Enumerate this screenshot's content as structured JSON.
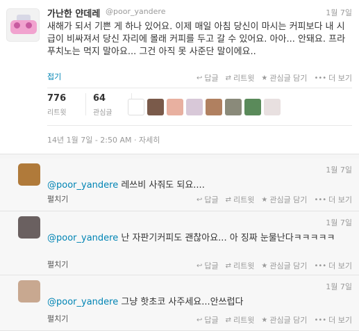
{
  "main_tweet": {
    "name": "가난한 얀데레",
    "handle": "@poor_yandere",
    "time": "1월 7일",
    "text": "새해가 되서 기쁜 게 하나 있어요. 이제 매일 아침 당신이 마시는 커피보다 내 시급이 비싸져서 당신 자리에 몰래 커피를 두고 갈 수 있어요. 아아... 안돼요. 프라푸치노는 먹지 말아요... 그건 아직 못 사준단 말이에요..",
    "collapse_label": "접기",
    "actions": {
      "reply": "답글",
      "retweet": "리트윗",
      "favorite": "관심글 담기",
      "more": "더 보기"
    },
    "stats": {
      "retweets_count": "776",
      "retweets_label": "리트윗",
      "favorites_count": "64",
      "favorites_label": "관심글"
    },
    "detail_time": "14년 1월 7일 - 2:50 AM",
    "detail_link": "자세히"
  },
  "favoriter_colors": [
    "#ffffff",
    "#7a5a4a",
    "#e8b0a0",
    "#d8c8d8",
    "#b08060",
    "#8a8a7a",
    "#5a8a5a",
    "#e8e0e0"
  ],
  "replies": [
    {
      "mention": "@poor_yandere",
      "text": " 레쓰비 사줘도 되요....",
      "time": "1월 7일",
      "expand": "펼치기",
      "avatar_color": "#b07a3a"
    },
    {
      "mention": "@poor_yandere",
      "text": " 난 자판기커피도 괜찮아요... 아 징짜 눈물난다ㅋㅋㅋㅋㅋ",
      "time": "1월 7일",
      "expand": "펼치기",
      "avatar_color": "#6a6060"
    },
    {
      "mention": "@poor_yandere",
      "text": " 그냥 핫초코 사주세요...안쓰럽다",
      "time": "1월 7일",
      "expand": "펼치기",
      "avatar_color": "#c8a890"
    }
  ],
  "reply_actions": {
    "reply": "답글",
    "retweet": "리트윗",
    "favorite": "관심글 담기",
    "more": "더 보기"
  }
}
